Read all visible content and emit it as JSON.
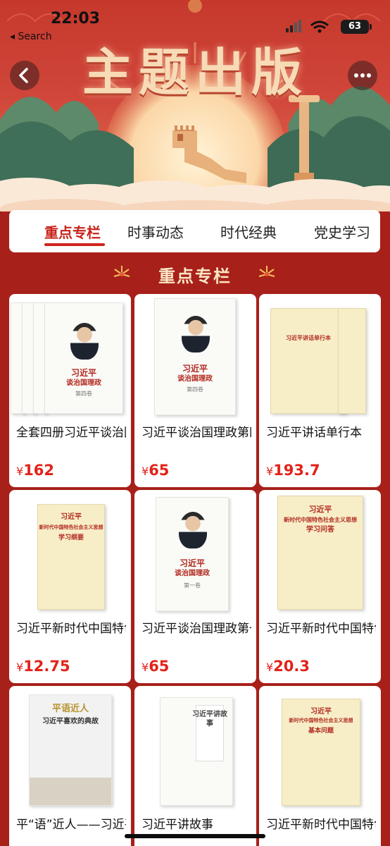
{
  "status_bar": {
    "time": "22:03",
    "back_app": "◂ Search",
    "battery": "63"
  },
  "banner": {
    "title": "主题出版"
  },
  "nav": {
    "back_glyph": "‹",
    "more_glyph": "•••"
  },
  "tabs": [
    {
      "label": "重点专栏",
      "active": true
    },
    {
      "label": "时事动态",
      "active": false
    },
    {
      "label": "时代经典",
      "active": false
    },
    {
      "label": "党史学习",
      "active": false
    }
  ],
  "section": {
    "title": "重点专栏"
  },
  "products": [
    {
      "name": "全套四册习近平谈治国理政",
      "currency": "¥",
      "price": "162",
      "cover": {
        "line1": "习近平",
        "line2": "谈治国理政",
        "line3": "第四卷"
      }
    },
    {
      "name": "习近平谈治国理政第四卷",
      "currency": "¥",
      "price": "65",
      "cover": {
        "line1": "习近平",
        "line2": "谈治国理政",
        "line3": "第四卷"
      }
    },
    {
      "name": "习近平讲话单行本",
      "currency": "¥",
      "price": "193.7",
      "cover": {
        "line1": "习近平讲话单行本",
        "line2": "",
        "line3": ""
      }
    },
    {
      "name": "习近平新时代中国特色社会主义思想学习纲要",
      "currency": "¥",
      "price": "12.75",
      "cover": {
        "line1": "习近平",
        "line2": "新时代中国特色社会主义思想",
        "line3": "学习纲要"
      }
    },
    {
      "name": "习近平谈治国理政第一卷",
      "currency": "¥",
      "price": "65",
      "cover": {
        "line1": "习近平",
        "line2": "谈治国理政",
        "line3": "第一卷"
      }
    },
    {
      "name": "习近平新时代中国特色社会主义思想学习问答",
      "currency": "¥",
      "price": "20.3",
      "cover": {
        "line1": "习近平",
        "line2": "新时代中国特色社会主义思想",
        "line3": "学习问答"
      }
    },
    {
      "name": "平“语”近人——习近平喜欢的典故",
      "currency": "",
      "price": "",
      "cover": {
        "line1": "平语近人",
        "line2": "习近平喜欢的典故",
        "line3": ""
      }
    },
    {
      "name": "习近平讲故事",
      "currency": "",
      "price": "",
      "cover": {
        "line1": "习近平讲故事",
        "line2": "",
        "line3": ""
      }
    },
    {
      "name": "习近平新时代中国特色社会主义思想基本问题",
      "currency": "",
      "price": "",
      "cover": {
        "line1": "习近平",
        "line2": "新时代中国特色社会主义思想",
        "line3": "基本问题"
      }
    }
  ],
  "colors": {
    "brand_red": "#a8201a",
    "price_red": "#e2231a",
    "tab_active": "#c8231b"
  }
}
